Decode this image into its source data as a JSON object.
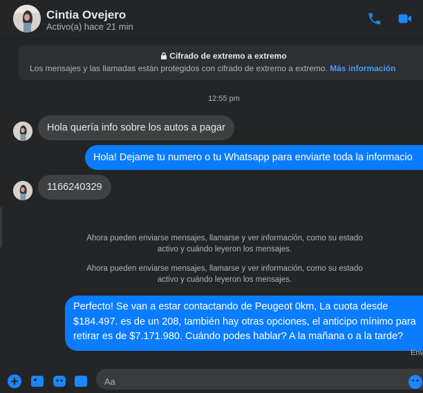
{
  "header": {
    "contact_name": "Cintia Ovejero",
    "status": "Activo(a) hace 21 min",
    "icons": [
      "phone-icon",
      "video-camera-icon"
    ]
  },
  "encryption": {
    "title": "Cifrado de extremo a extremo",
    "description": "Los mensajes y las llamadas están protegidos con cifrado de extremo a extremo.",
    "link": "Más información"
  },
  "timestamp": "12:55 pm",
  "messages": [
    {
      "direction": "incoming",
      "text": "Hola quería info sobre los autos a pagar"
    },
    {
      "direction": "outgoing",
      "text": "Hola! Dejame tu numero o tu Whatsapp para enviarte toda la informacio"
    },
    {
      "direction": "incoming",
      "text": "1166240329"
    }
  ],
  "system_messages": [
    {
      "line1": "Ahora pueden enviarse mensajes, llamarse y ver información, como su estado",
      "line2": "activo y cuándo leyeron los mensajes."
    },
    {
      "line1": "Ahora pueden enviarse mensajes, llamarse y ver información, como su estado",
      "line2": "activo y cuándo leyeron los mensajes."
    }
  ],
  "last_message": {
    "line1": "Perfecto!  Se van a estar contactando de Peugeot 0km, La cuota desde",
    "line2": "$184.497. es de un 208, también hay otras opciones, el anticipo mínimo para",
    "line3": "retirar es de $7.171.980. Cuándo podes hablar? A la mañana o a la tarde?",
    "status": "Env"
  },
  "composer": {
    "placeholder": "Aa",
    "icons": [
      "plus-icon",
      "image-icon",
      "sticker-icon",
      "gif-icon",
      "emoji-icon"
    ]
  },
  "colors": {
    "outgoing_bubble": "#0a7cff",
    "incoming_bubble": "#3e4042",
    "background": "#242526",
    "accent": "#4599ff"
  }
}
